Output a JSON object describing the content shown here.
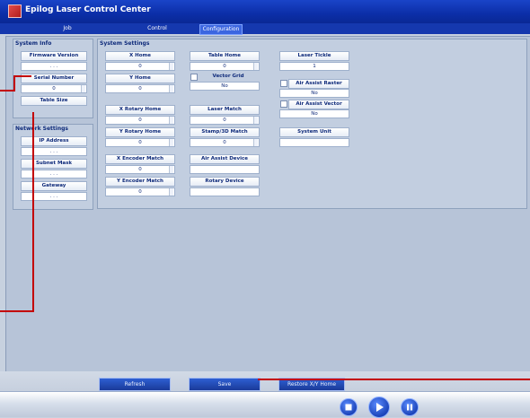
{
  "window": {
    "title": "Epilog Laser Control Center"
  },
  "tabs": [
    {
      "label": "Job"
    },
    {
      "label": "Control"
    },
    {
      "label": "Configuration"
    }
  ],
  "system_info": {
    "title": "System Info",
    "firmware_label": "Firmware Version",
    "firmware_value": ". . .",
    "serial_label": "Serial Number",
    "serial_value": "0",
    "table_size_label": "Table Size"
  },
  "network": {
    "title": "Network Settings",
    "ip_label": "IP Address",
    "ip_value": ". . .",
    "subnet_label": "Subnet Mask",
    "subnet_value": ". . .",
    "gateway_label": "Gateway",
    "gateway_value": ". . ."
  },
  "system_settings": {
    "title": "System Settings",
    "x_home_label": "X Home",
    "x_home_value": "0",
    "y_home_label": "Y Home",
    "y_home_value": "0",
    "x_rotary_label": "X Rotary Home",
    "x_rotary_value": "0",
    "y_rotary_label": "Y Rotary Home",
    "y_rotary_value": "0",
    "x_encoder_label": "X Encoder Match",
    "x_encoder_value": "0",
    "y_encoder_label": "Y Encoder Match",
    "y_encoder_value": "0",
    "table_home_label": "Table Home",
    "table_home_value": "0",
    "vector_grid_label": "Vector Grid",
    "vector_grid_value": "No",
    "laser_match_label": "Laser Match",
    "laser_match_value": "0",
    "stamp_label": "Stamp/3D Match",
    "stamp_value": "0",
    "air_assist_device_label": "Air Assist Device",
    "rotary_device_label": "Rotary Device",
    "laser_tickle_label": "Laser Tickle",
    "laser_tickle_value": "1",
    "air_assist_raster_label": "Air Assist Raster",
    "air_assist_raster_value": "No",
    "air_assist_vector_label": "Air Assist Vector",
    "air_assist_vector_value": "No",
    "system_unit_label": "System Unit"
  },
  "actions": {
    "refresh": "Refresh",
    "save": "Save",
    "restore": "Restore X/Y Home"
  }
}
